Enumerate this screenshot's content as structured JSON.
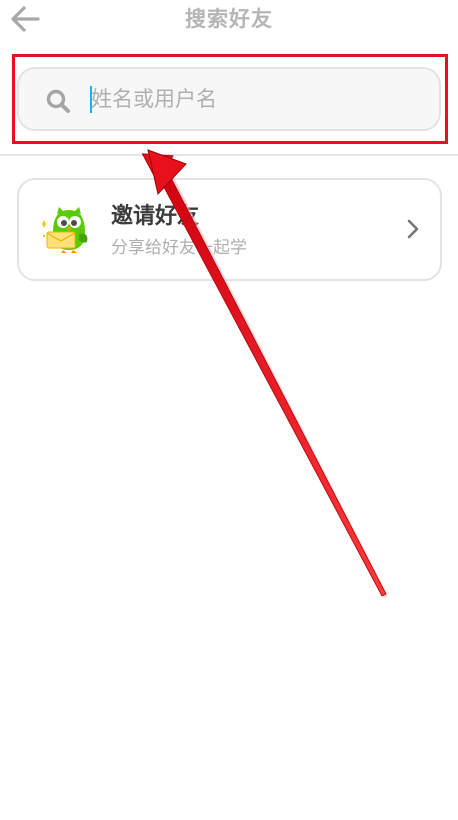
{
  "header": {
    "title": "搜索好友",
    "back_icon": "arrow-left-icon"
  },
  "search": {
    "placeholder": "姓名或用户名",
    "value": "",
    "icon": "search-icon"
  },
  "invite": {
    "title": "邀请好友",
    "subtitle": "分享给好友一起学",
    "icon": "duo-owl-mascot-icon",
    "chevron": "chevron-right-icon"
  },
  "annotation": {
    "highlight_color": "#e8101c",
    "arrow_color": "#e8101c"
  },
  "colors": {
    "accent": "#1cb0f6",
    "border": "#e3e3e3",
    "mascot_green": "#58cc02"
  }
}
